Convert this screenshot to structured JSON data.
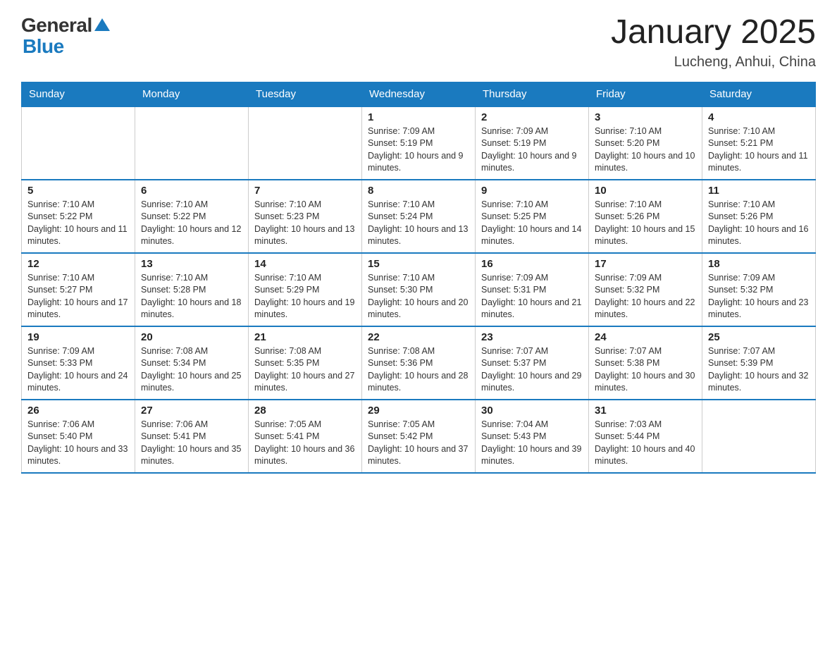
{
  "header": {
    "logo": {
      "general": "General",
      "blue": "Blue"
    },
    "title": "January 2025",
    "location": "Lucheng, Anhui, China"
  },
  "calendar": {
    "days_of_week": [
      "Sunday",
      "Monday",
      "Tuesday",
      "Wednesday",
      "Thursday",
      "Friday",
      "Saturday"
    ],
    "weeks": [
      [
        {
          "day": "",
          "info": ""
        },
        {
          "day": "",
          "info": ""
        },
        {
          "day": "",
          "info": ""
        },
        {
          "day": "1",
          "info": "Sunrise: 7:09 AM\nSunset: 5:19 PM\nDaylight: 10 hours and 9 minutes."
        },
        {
          "day": "2",
          "info": "Sunrise: 7:09 AM\nSunset: 5:19 PM\nDaylight: 10 hours and 9 minutes."
        },
        {
          "day": "3",
          "info": "Sunrise: 7:10 AM\nSunset: 5:20 PM\nDaylight: 10 hours and 10 minutes."
        },
        {
          "day": "4",
          "info": "Sunrise: 7:10 AM\nSunset: 5:21 PM\nDaylight: 10 hours and 11 minutes."
        }
      ],
      [
        {
          "day": "5",
          "info": "Sunrise: 7:10 AM\nSunset: 5:22 PM\nDaylight: 10 hours and 11 minutes."
        },
        {
          "day": "6",
          "info": "Sunrise: 7:10 AM\nSunset: 5:22 PM\nDaylight: 10 hours and 12 minutes."
        },
        {
          "day": "7",
          "info": "Sunrise: 7:10 AM\nSunset: 5:23 PM\nDaylight: 10 hours and 13 minutes."
        },
        {
          "day": "8",
          "info": "Sunrise: 7:10 AM\nSunset: 5:24 PM\nDaylight: 10 hours and 13 minutes."
        },
        {
          "day": "9",
          "info": "Sunrise: 7:10 AM\nSunset: 5:25 PM\nDaylight: 10 hours and 14 minutes."
        },
        {
          "day": "10",
          "info": "Sunrise: 7:10 AM\nSunset: 5:26 PM\nDaylight: 10 hours and 15 minutes."
        },
        {
          "day": "11",
          "info": "Sunrise: 7:10 AM\nSunset: 5:26 PM\nDaylight: 10 hours and 16 minutes."
        }
      ],
      [
        {
          "day": "12",
          "info": "Sunrise: 7:10 AM\nSunset: 5:27 PM\nDaylight: 10 hours and 17 minutes."
        },
        {
          "day": "13",
          "info": "Sunrise: 7:10 AM\nSunset: 5:28 PM\nDaylight: 10 hours and 18 minutes."
        },
        {
          "day": "14",
          "info": "Sunrise: 7:10 AM\nSunset: 5:29 PM\nDaylight: 10 hours and 19 minutes."
        },
        {
          "day": "15",
          "info": "Sunrise: 7:10 AM\nSunset: 5:30 PM\nDaylight: 10 hours and 20 minutes."
        },
        {
          "day": "16",
          "info": "Sunrise: 7:09 AM\nSunset: 5:31 PM\nDaylight: 10 hours and 21 minutes."
        },
        {
          "day": "17",
          "info": "Sunrise: 7:09 AM\nSunset: 5:32 PM\nDaylight: 10 hours and 22 minutes."
        },
        {
          "day": "18",
          "info": "Sunrise: 7:09 AM\nSunset: 5:32 PM\nDaylight: 10 hours and 23 minutes."
        }
      ],
      [
        {
          "day": "19",
          "info": "Sunrise: 7:09 AM\nSunset: 5:33 PM\nDaylight: 10 hours and 24 minutes."
        },
        {
          "day": "20",
          "info": "Sunrise: 7:08 AM\nSunset: 5:34 PM\nDaylight: 10 hours and 25 minutes."
        },
        {
          "day": "21",
          "info": "Sunrise: 7:08 AM\nSunset: 5:35 PM\nDaylight: 10 hours and 27 minutes."
        },
        {
          "day": "22",
          "info": "Sunrise: 7:08 AM\nSunset: 5:36 PM\nDaylight: 10 hours and 28 minutes."
        },
        {
          "day": "23",
          "info": "Sunrise: 7:07 AM\nSunset: 5:37 PM\nDaylight: 10 hours and 29 minutes."
        },
        {
          "day": "24",
          "info": "Sunrise: 7:07 AM\nSunset: 5:38 PM\nDaylight: 10 hours and 30 minutes."
        },
        {
          "day": "25",
          "info": "Sunrise: 7:07 AM\nSunset: 5:39 PM\nDaylight: 10 hours and 32 minutes."
        }
      ],
      [
        {
          "day": "26",
          "info": "Sunrise: 7:06 AM\nSunset: 5:40 PM\nDaylight: 10 hours and 33 minutes."
        },
        {
          "day": "27",
          "info": "Sunrise: 7:06 AM\nSunset: 5:41 PM\nDaylight: 10 hours and 35 minutes."
        },
        {
          "day": "28",
          "info": "Sunrise: 7:05 AM\nSunset: 5:41 PM\nDaylight: 10 hours and 36 minutes."
        },
        {
          "day": "29",
          "info": "Sunrise: 7:05 AM\nSunset: 5:42 PM\nDaylight: 10 hours and 37 minutes."
        },
        {
          "day": "30",
          "info": "Sunrise: 7:04 AM\nSunset: 5:43 PM\nDaylight: 10 hours and 39 minutes."
        },
        {
          "day": "31",
          "info": "Sunrise: 7:03 AM\nSunset: 5:44 PM\nDaylight: 10 hours and 40 minutes."
        },
        {
          "day": "",
          "info": ""
        }
      ]
    ]
  }
}
